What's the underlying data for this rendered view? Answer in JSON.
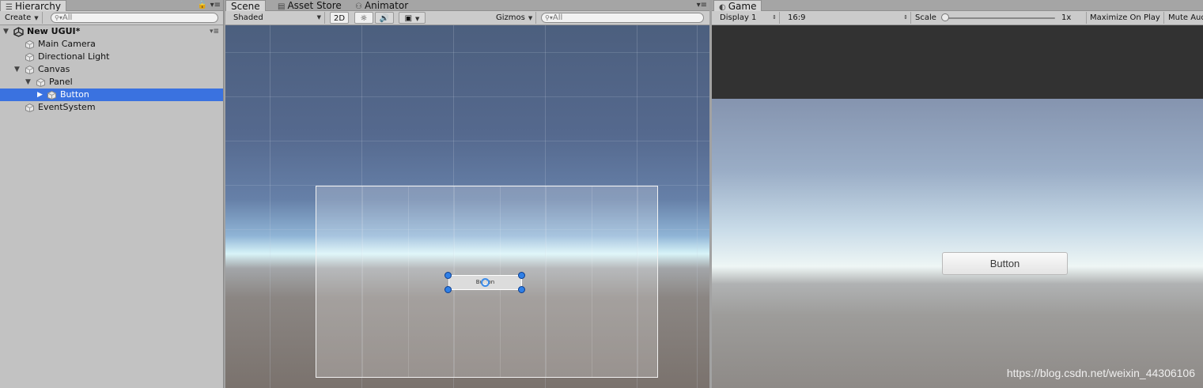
{
  "hierarchy": {
    "tab_label": "Hierarchy",
    "lock_icon": "lock-icon",
    "menu_icon": "menu-icon",
    "create_label": "Create",
    "search_placeholder": "All",
    "scene_name": "New UGUI*",
    "items": [
      {
        "label": "Main Camera"
      },
      {
        "label": "Directional Light"
      },
      {
        "label": "Canvas"
      },
      {
        "label": "Panel"
      },
      {
        "label": "Button"
      },
      {
        "label": "EventSystem"
      }
    ],
    "selected_item": "Button"
  },
  "scene": {
    "tabs": [
      {
        "label": "Scene",
        "icon": "scene-icon"
      },
      {
        "label": "Asset Store",
        "icon": "store-icon"
      },
      {
        "label": "Animator",
        "icon": "animator-icon"
      }
    ],
    "shading_mode": "Shaded",
    "mode_2d": "2D",
    "gizmos_label": "Gizmos",
    "search_placeholder": "All",
    "button_text": "Button"
  },
  "game": {
    "tab_label": "Game",
    "display": "Display 1",
    "aspect": "16:9",
    "scale_label": "Scale",
    "scale_value": "1x",
    "maximize_label": "Maximize On Play",
    "mute_label": "Mute Audio",
    "button_text": "Button"
  },
  "watermark": "https://blog.csdn.net/weixin_44306106",
  "colors": {
    "selection": "#3a72e0",
    "handle": "#2f7fe6"
  }
}
